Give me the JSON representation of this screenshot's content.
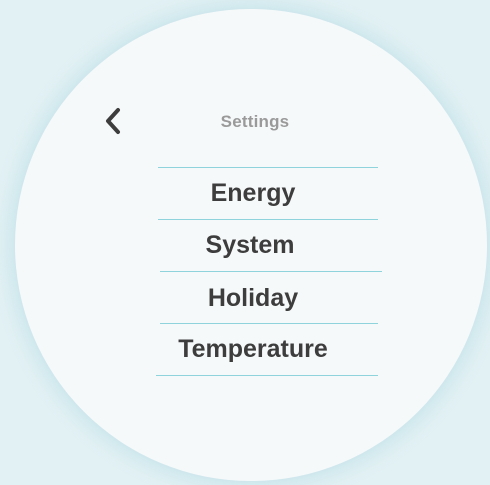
{
  "header": {
    "title": "Settings",
    "back_icon": "chevron-left-icon"
  },
  "menu": {
    "items": [
      {
        "label": "Energy"
      },
      {
        "label": "System"
      },
      {
        "label": "Holiday"
      },
      {
        "label": "Temperature"
      }
    ]
  },
  "colors": {
    "background": "#e2f1f4",
    "dial": "#f6f9fa",
    "divider": "#8fd3dd",
    "text": "#3d3d3d",
    "title": "#9a9a9a"
  }
}
